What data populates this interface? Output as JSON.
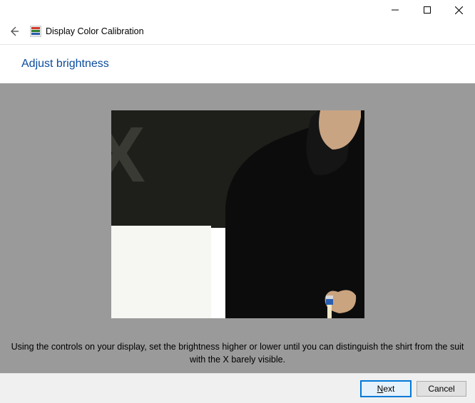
{
  "window": {
    "app_title": "Display Color Calibration"
  },
  "page": {
    "heading": "Adjust brightness",
    "instruction": "Using the controls on your display, set the brightness higher or lower until you can distinguish the shirt from the suit with the X barely visible."
  },
  "footer": {
    "next_label": "Next",
    "cancel_label": "Cancel"
  }
}
